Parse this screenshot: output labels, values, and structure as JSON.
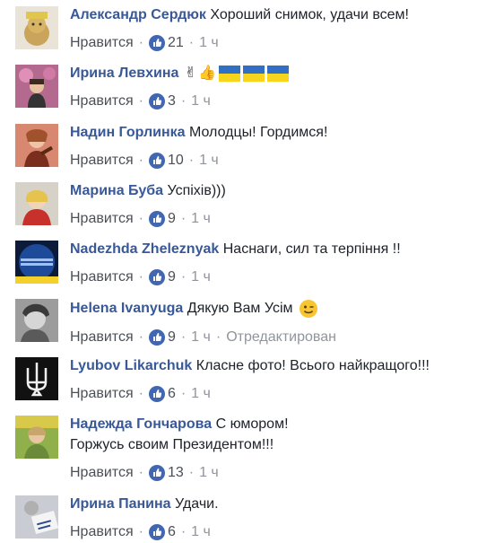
{
  "ui": {
    "like_label": "Нравится",
    "separator": "·",
    "edited_label": "Отредактирован"
  },
  "comments": [
    {
      "author": "Александр Сердюк",
      "text": "Хороший снимок, удачи всем!",
      "likes": "21",
      "time": "1 ч",
      "avatar_icon": "teddy-bear-avatar"
    },
    {
      "author": "Ирина Левхина",
      "text": "",
      "emojis": [
        "victory-hand-emoji",
        "thumbs-up-emoji",
        "ukraine-flag-emoji",
        "ukraine-flag-emoji",
        "ukraine-flag-emoji"
      ],
      "likes": "3",
      "time": "1 ч",
      "avatar_icon": "woman-flowers-avatar"
    },
    {
      "author": "Надин Горлинка",
      "text": "Молодцы! Гордимся!",
      "likes": "10",
      "time": "1 ч",
      "avatar_icon": "violinist-avatar"
    },
    {
      "author": "Марина Буба",
      "text": "Успіхів)))",
      "likes": "9",
      "time": "1 ч",
      "avatar_icon": "woman-red-scarf-avatar"
    },
    {
      "author": "Nadezhda Zheleznyak",
      "text": "Наснаги, сил та терпіння !!",
      "likes": "9",
      "time": "1 ч",
      "avatar_icon": "blue-badge-avatar"
    },
    {
      "author": "Helena Ivanyuga",
      "text": "Дякую Вам Усім",
      "emojis": [
        "winking-face-emoji"
      ],
      "likes": "9",
      "time": "1 ч",
      "edited": true,
      "avatar_icon": "woman-bw-avatar"
    },
    {
      "author": "Lyubov Likarchuk",
      "text": "Класне фото! Всього найкращого!!!",
      "likes": "6",
      "time": "1 ч",
      "avatar_icon": "trident-avatar"
    },
    {
      "author": "Надежда Гончарова",
      "text": "С юмором!",
      "text2": "Горжусь своим Президентом!!!",
      "likes": "13",
      "time": "1 ч",
      "avatar_icon": "woman-field-avatar"
    },
    {
      "author": "Ирина Панина",
      "text": "Удачи.",
      "likes": "6",
      "time": "1 ч",
      "avatar_icon": "woman-sign-avatar"
    }
  ],
  "colors": {
    "author": "#385898",
    "meta": "#90949c",
    "like_blue": "#4267b2"
  }
}
